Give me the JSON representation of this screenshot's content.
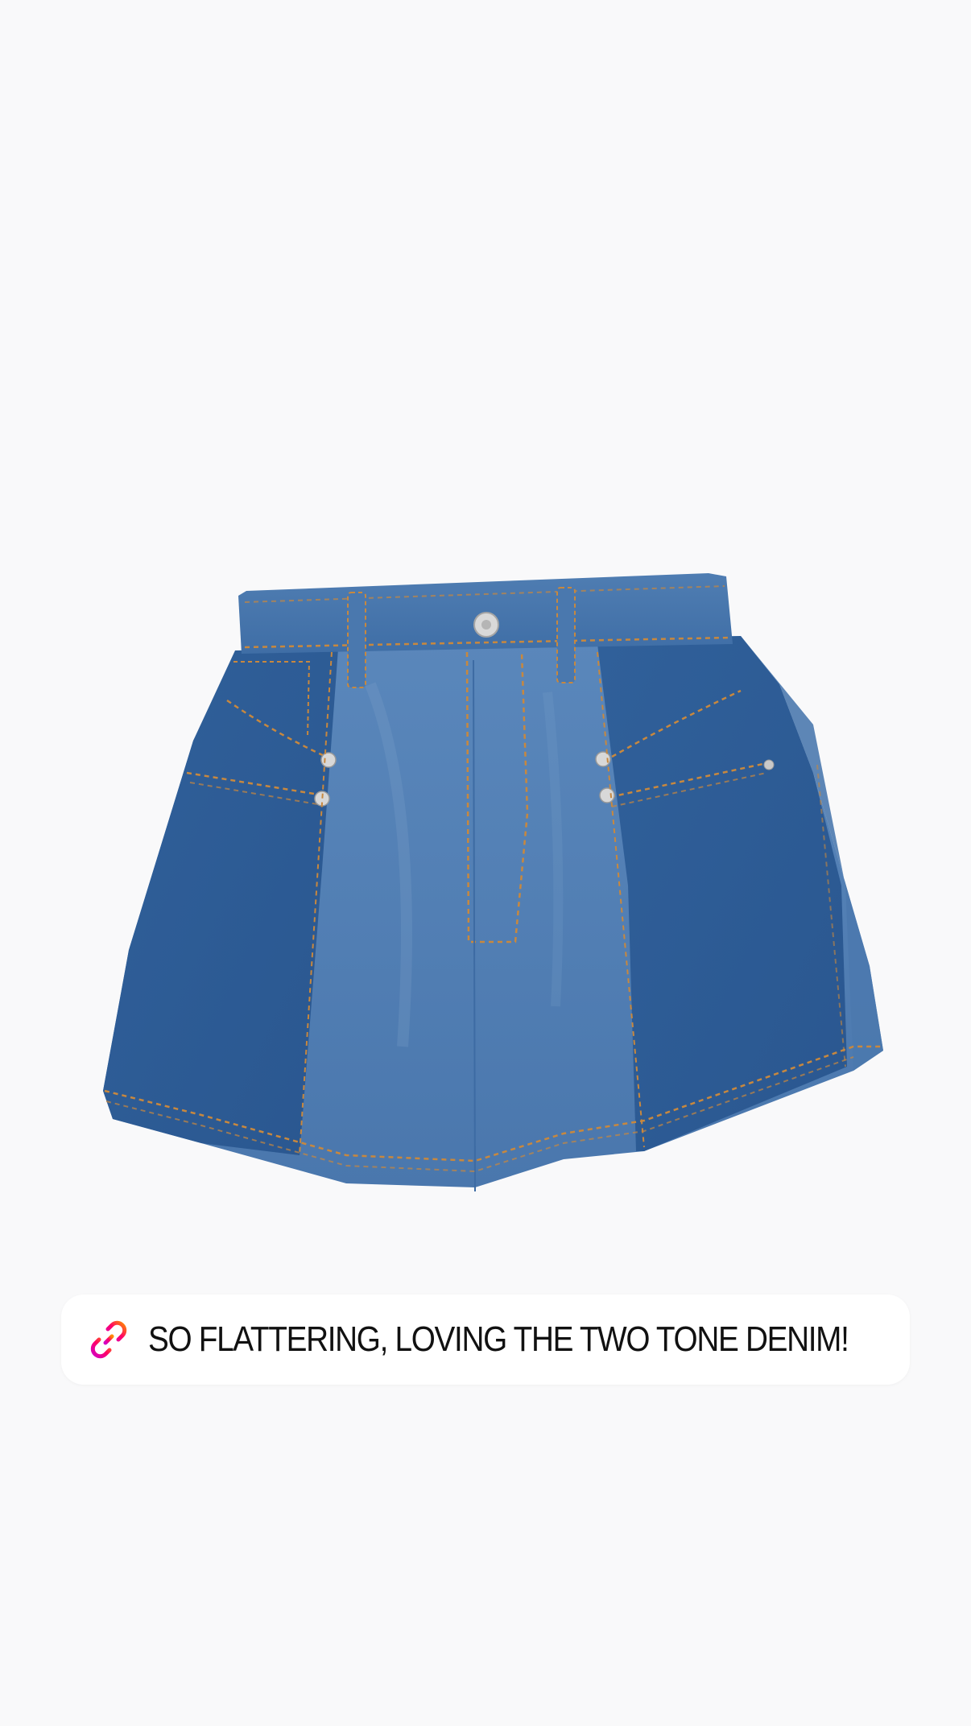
{
  "story": {
    "product_image": "denim-shorts-two-tone",
    "link_sticker": {
      "icon": "link-icon",
      "label": "SO FLATTERING, LOVING THE TWO TONE DENIM!"
    }
  },
  "colors": {
    "background": "#f9f9fa",
    "denim_dark": "#2e5f98",
    "denim_light": "#4f7eb3",
    "stitching": "#c8883e",
    "icon_gradient_start": "#ff8a00",
    "icon_gradient_end": "#d300c5"
  }
}
